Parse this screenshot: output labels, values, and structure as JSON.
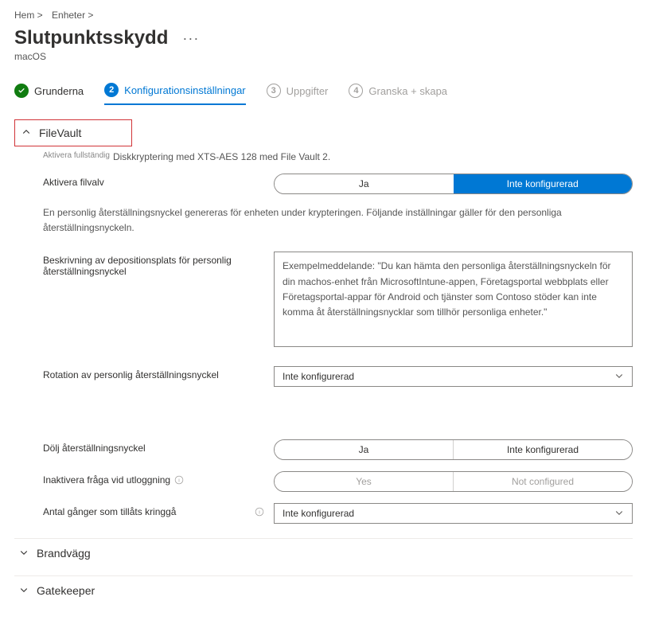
{
  "breadcrumb": [
    "Hem >",
    "Enheter >"
  ],
  "title": "Slutpunktsskydd",
  "subtitle": "macOS",
  "stepper": [
    {
      "label": "Grunderna",
      "state": "done"
    },
    {
      "num": "2",
      "label": "Konfigurationsinställningar",
      "state": "active"
    },
    {
      "num": "3",
      "label": "Uppgifter",
      "state": "pending"
    },
    {
      "num": "4",
      "label": "Granska + skapa",
      "state": "pending"
    }
  ],
  "filevault": {
    "name": "FileVault",
    "enable_tiny": "Aktivera fullständig",
    "desc": "Diskkryptering med XTS-AES 128 med File Vault 2.",
    "enable_label": "Aktivera filvalv",
    "enable_options": [
      "Ja",
      "Inte konfigurerad"
    ],
    "note": "En personlig återställningsnyckel genereras för enheten under krypteringen. Följande inställningar gäller för den personliga återställningsnyckeln.",
    "escrow_label": "Beskrivning av depositionsplats för personlig återställningsnyckel",
    "escrow_value": "Exempelmeddelande: \"Du kan hämta den personliga återställningsnyckeln för din machos-enhet från MicrosoftIntune-appen, Företagsportal webbplats eller Företagsportal-appar för Android och tjänster som Contoso stöder kan inte komma åt återställningsnycklar som tillhör personliga enheter.\"",
    "rotation_label": "Rotation av personlig återställningsnyckel",
    "rotation_value": "Inte konfigurerad",
    "hide_label": "Dölj återställningsnyckel",
    "hide_options": [
      "Ja",
      "Inte konfigurerad"
    ],
    "disable_prompt_label": "Inaktivera fråga vid utloggning",
    "disable_prompt_options": [
      "Yes",
      "Not configured"
    ],
    "bypass_label": "Antal gånger som tillåts kringgå",
    "bypass_value": "Inte konfigurerad"
  },
  "firewall": {
    "name": "Brandvägg"
  },
  "gatekeeper": {
    "name": "Gatekeeper"
  }
}
